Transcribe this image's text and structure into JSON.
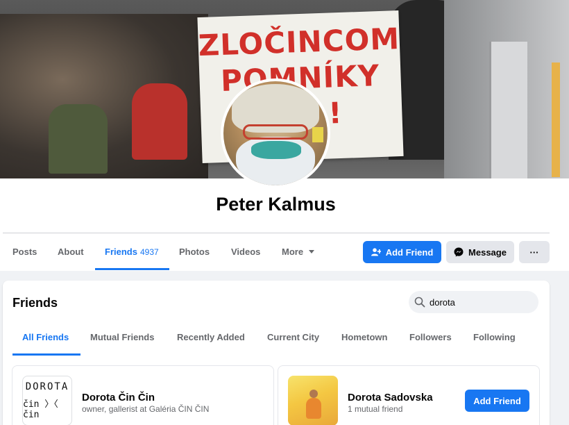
{
  "cover": {
    "banner_lines": [
      "ZLOČINCOM",
      "POMNÍKY",
      "NIE !"
    ]
  },
  "profile": {
    "name": "Peter Kalmus"
  },
  "nav": {
    "tabs": [
      {
        "label": "Posts"
      },
      {
        "label": "About"
      },
      {
        "label": "Friends",
        "count": "4937"
      },
      {
        "label": "Photos"
      },
      {
        "label": "Videos"
      },
      {
        "label": "More"
      }
    ],
    "active_tab": "Friends"
  },
  "actions": {
    "add_friend": "Add Friend",
    "message": "Message",
    "more": "···"
  },
  "friends_section": {
    "title": "Friends",
    "search": {
      "value": "dorota",
      "placeholder": "Search"
    },
    "tabs": [
      "All Friends",
      "Mutual Friends",
      "Recently Added",
      "Current City",
      "Hometown",
      "Followers",
      "Following"
    ],
    "active_tab": "All Friends",
    "results": [
      {
        "name": "Dorota Čin Čin",
        "subtitle": "owner, gallerist at Galéria ČIN ČIN",
        "thumb_text_top": "DOROTA",
        "thumb_text_bottom": "čin 〉〈 čin"
      },
      {
        "name": "Dorota Sadovska",
        "subtitle": "1 mutual friend",
        "button": "Add Friend"
      }
    ]
  },
  "colors": {
    "accent": "#1877f2",
    "secondary_text": "#65676b",
    "page_bg": "#f0f2f5"
  }
}
